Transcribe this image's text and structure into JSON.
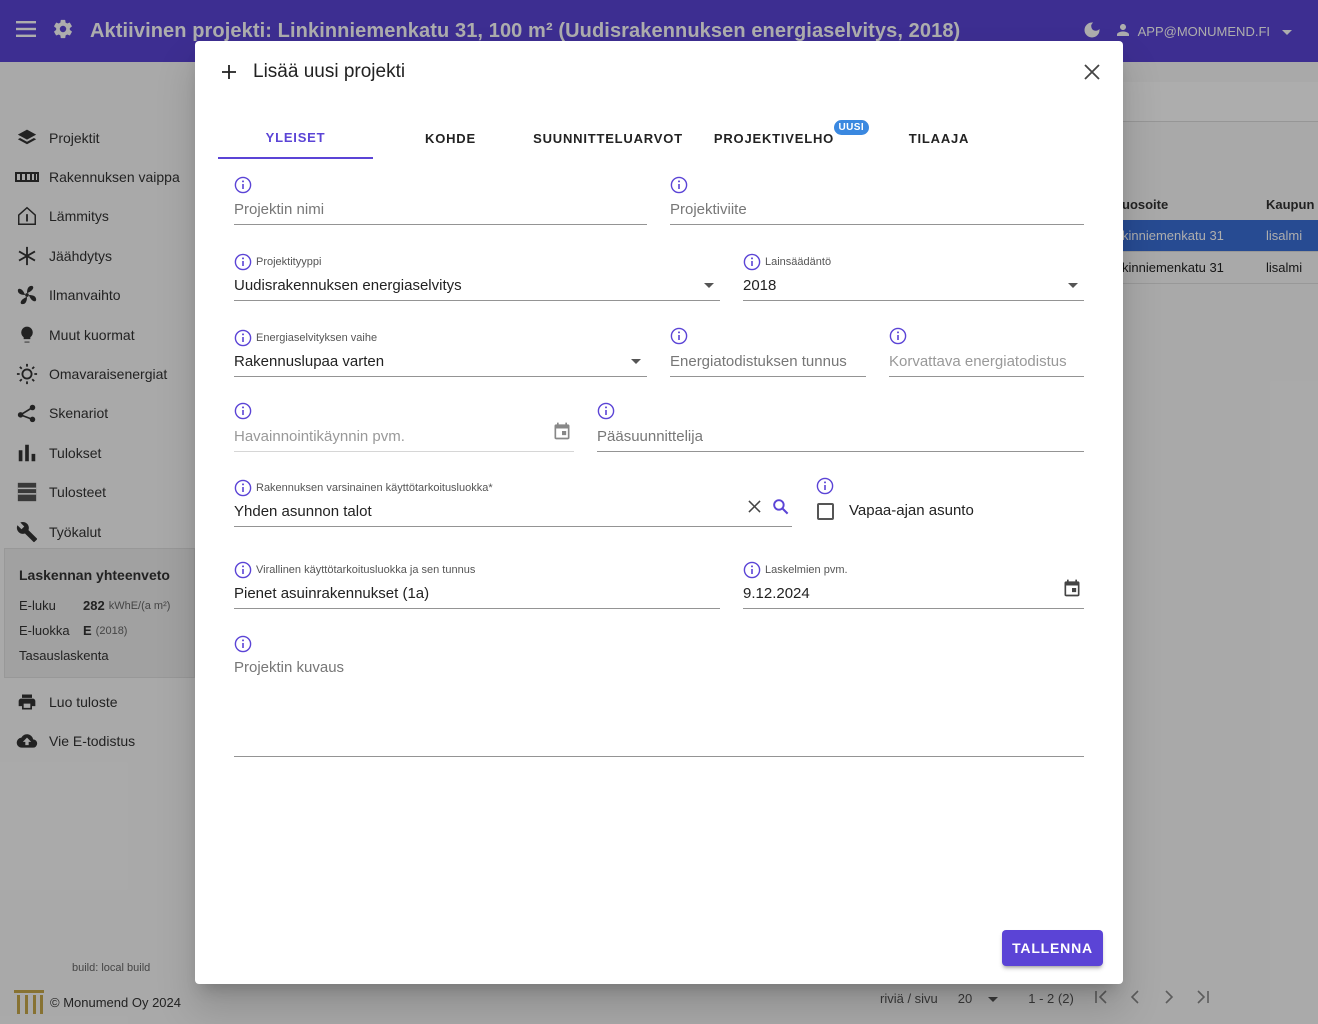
{
  "appbar": {
    "title": "Aktiivinen projekti: Linkinniemenkatu 31, 100 m² (Uudisrakennuksen energiaselvitys, 2018)",
    "user_email": "APP@MONUMEND.FI",
    "color": "#5b44d6"
  },
  "sidebar": {
    "items": [
      {
        "label": "Projektit",
        "icon": "layers-icon"
      },
      {
        "label": "Rakennuksen vaippa",
        "icon": "wall-icon"
      },
      {
        "label": "Lämmitys",
        "icon": "house-heat-icon"
      },
      {
        "label": "Jäähdytys",
        "icon": "snowflake-icon"
      },
      {
        "label": "Ilmanvaihto",
        "icon": "fan-icon"
      },
      {
        "label": "Muut kuormat",
        "icon": "bulb-icon"
      },
      {
        "label": "Omavaraisenergiat",
        "icon": "sun-icon"
      },
      {
        "label": "Skenariot",
        "icon": "share-icon"
      },
      {
        "label": "Tulokset",
        "icon": "bar-chart-icon"
      },
      {
        "label": "Tulosteet",
        "icon": "document-icon"
      },
      {
        "label": "Työkalut",
        "icon": "wrench-icon"
      }
    ],
    "summary": {
      "title": "Laskennan yhteenveto",
      "eluku_label": "E-luku",
      "eluku_value": "282",
      "eluku_unit": "kWhE/(a m²)",
      "eluokka_label": "E-luokka",
      "eluokka_value": "E",
      "eluokka_unit": "(2018)",
      "tasaus_label": "Tasauslaskenta"
    },
    "actions": [
      {
        "label": "Luo tuloste",
        "icon": "printer-icon"
      },
      {
        "label": "Vie E-todistus",
        "icon": "cloud-upload-icon"
      }
    ],
    "build": "build: local build",
    "copyright": "© Monumend Oy 2024"
  },
  "background_table": {
    "headers": [
      "uosoite",
      "Kaupun"
    ],
    "rows": [
      [
        "kinniemenkatu 31",
        "lisalmi"
      ],
      [
        "kinniemenkatu 31",
        "lisalmi"
      ]
    ],
    "pager": {
      "rows_label": "riviä / sivu",
      "rows_value": "20",
      "range": "1 - 2 (2)"
    }
  },
  "dialog": {
    "title": "Lisää uusi projekti",
    "tabs": [
      {
        "label": "YLEISET",
        "active": true
      },
      {
        "label": "KOHDE"
      },
      {
        "label": "SUUNNITTELUARVOT"
      },
      {
        "label": "PROJEKTIVELHO",
        "badge": "UUSI"
      },
      {
        "label": "TILAAJA"
      }
    ],
    "fields": {
      "projektin_nimi": {
        "placeholder": "Projektin nimi"
      },
      "projektiviite": {
        "placeholder": "Projektiviite"
      },
      "projektityyppi": {
        "label": "Projektityyppi",
        "value": "Uudisrakennuksen energiaselvitys"
      },
      "lainsaadanto": {
        "label": "Lainsäädäntö",
        "value": "2018"
      },
      "vaihe": {
        "label": "Energiaselvityksen vaihe",
        "value": "Rakennuslupaa varten"
      },
      "todistus_tunnus": {
        "placeholder": "Energiatodistuksen tunnus"
      },
      "korvattava": {
        "placeholder": "Korvattava energiatodistus"
      },
      "havainnointi": {
        "placeholder": "Havainnointikäynnin pvm."
      },
      "paasuunnittelija": {
        "placeholder": "Pääsuunnittelija"
      },
      "kayttotarkoitus": {
        "label": "Rakennuksen varsinainen käyttötarkoitusluokka*",
        "value": "Yhden asunnon talot"
      },
      "vapaa_ajan": {
        "label": "Vapaa-ajan asunto",
        "checked": false
      },
      "virallinen": {
        "label": "Virallinen käyttötarkoitusluokka ja sen tunnus",
        "value": "Pienet asuinrakennukset (1a)"
      },
      "laskelmien_pvm": {
        "label": "Laskelmien pvm.",
        "value": "9.12.2024"
      },
      "kuvaus": {
        "placeholder": "Projektin kuvaus"
      }
    },
    "save_label": "TALLENNA"
  }
}
